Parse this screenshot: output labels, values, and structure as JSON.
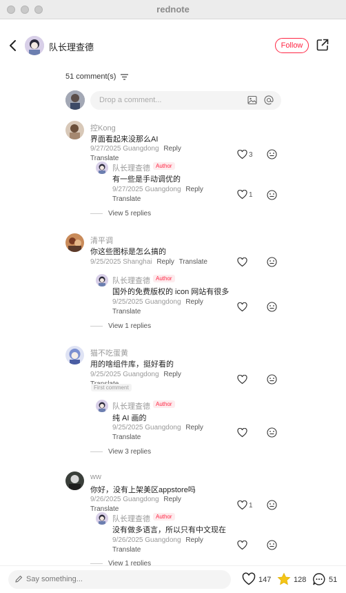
{
  "window": {
    "title": "rednote"
  },
  "header": {
    "author_name": "队长理查德",
    "follow_label": "Follow"
  },
  "comments_header": {
    "count_label": "51 comment(s)"
  },
  "input": {
    "placeholder": "Drop a comment..."
  },
  "threads": [
    {
      "user": "控Kong",
      "text": "界面看起来没那么AI",
      "date": "9/27/2025 Guangdong",
      "reply_label": "Reply",
      "translate_label": "Translate",
      "likes": "3",
      "reply": {
        "user": "队长理查德",
        "badge": "Author",
        "text": "有一些是手动调优的",
        "date": "9/27/2025 Guangdong",
        "reply_label": "Reply",
        "translate_label": "Translate",
        "likes": "1"
      },
      "view_replies": "View 5 replies"
    },
    {
      "user": "清平调",
      "text": "你这些图标是怎么搞的",
      "date": "9/25/2025 Shanghai",
      "reply_label": "Reply",
      "translate_label": "Translate",
      "likes": "",
      "reply": {
        "user": "队长理查德",
        "badge": "Author",
        "text": "国外的免费版权的  icon 网站有很多",
        "date": "9/25/2025 Guangdong",
        "reply_label": "Reply",
        "translate_label": "Translate",
        "likes": ""
      },
      "view_replies": "View 1 replies"
    },
    {
      "user": "猫不吃蛋黄",
      "text": "用的啥组件库，挺好看的",
      "date": "9/25/2025 Guangdong",
      "reply_label": "Reply",
      "translate_label": "Translate",
      "first_badge": "First comment",
      "likes": "",
      "reply": {
        "user": "队长理查德",
        "badge": "Author",
        "text": "纯 AI 画的",
        "date": "9/25/2025 Guangdong",
        "reply_label": "Reply",
        "translate_label": "Translate",
        "likes": ""
      },
      "view_replies": "View 3 replies"
    },
    {
      "user": "ww",
      "text": "你好，没有上架美区appstore吗",
      "date": "9/26/2025 Guangdong",
      "reply_label": "Reply",
      "translate_label": "Translate",
      "likes": "1",
      "reply": {
        "user": "队长理查德",
        "badge": "Author",
        "text": "没有做多语言，所以只有中文现在",
        "date": "9/26/2025 Guangdong",
        "reply_label": "Reply",
        "translate_label": "Translate",
        "likes": ""
      },
      "view_replies": "View 1 replies"
    }
  ],
  "bottom": {
    "placeholder": "Say something...",
    "likes": "147",
    "collects": "128",
    "comments": "51"
  },
  "colors": {
    "accent": "#ff2442",
    "star": "#f5c518"
  }
}
